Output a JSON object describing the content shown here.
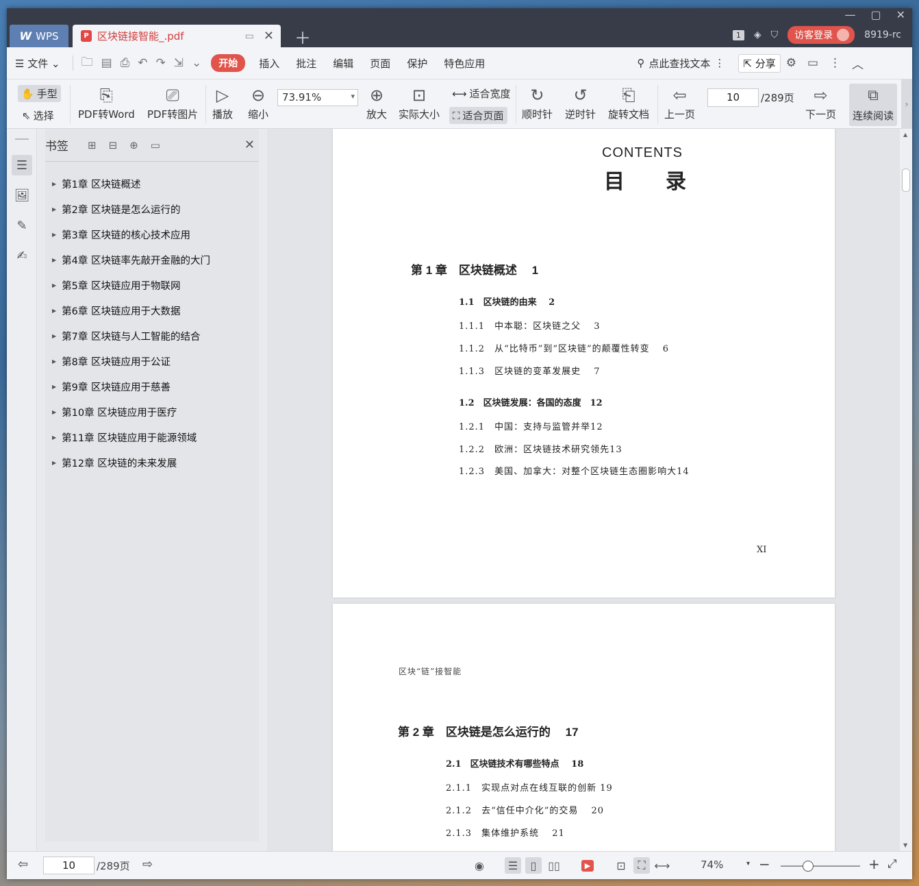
{
  "titlebar": {
    "app_tab": "WPS",
    "doc_tab": "区块链接智能_.pdf",
    "badge": "1",
    "guest_login": "访客登录",
    "user_code": "8919-rc"
  },
  "menubar": {
    "file": "文件",
    "tabs": [
      "开始",
      "插入",
      "批注",
      "编辑",
      "页面",
      "保护",
      "特色应用"
    ],
    "search": "点此查找文本",
    "share": "分享"
  },
  "toolbar": {
    "hand": "手型",
    "select": "选择",
    "pdf_to_word": "PDF转Word",
    "pdf_to_image": "PDF转图片",
    "play": "播放",
    "zoom_out": "缩小",
    "zoom_value": "73.91%",
    "zoom_in": "放大",
    "actual_size": "实际大小",
    "fit_width": "适合宽度",
    "fit_page": "适合页面",
    "clockwise": "顺时针",
    "counterclockwise": "逆时针",
    "rotate_doc": "旋转文档",
    "prev_page": "上一页",
    "page_current": "10",
    "page_total": "/289页",
    "next_page": "下一页",
    "continuous_read": "连续阅读"
  },
  "bookmarks": {
    "title": "书签",
    "items": [
      "第1章 区块链概述",
      "第2章 区块链是怎么运行的",
      "第3章 区块链的核心技术应用",
      "第4章 区块链率先敲开金融的大门",
      "第5章 区块链应用于物联网",
      "第6章 区块链应用于大数据",
      "第7章 区块链与人工智能的结合",
      "第8章 区块链应用于公证",
      "第9章 区块链应用于慈善",
      "第10章 区块链应用于医疗",
      "第11章 区块链应用于能源领域",
      "第12章 区块链的未来发展"
    ]
  },
  "page1": {
    "contents_en": "CONTENTS",
    "contents_zh": "目　　录",
    "chapter": "第 1 章　区块链概述　 1",
    "s1": "1.1　区块链的由来　 2",
    "s111": "1.1.1　中本聪：区块链之父　 3",
    "s112": "1.1.2　从“比特币”到“区块链”的颠覆性转变　 6",
    "s113": "1.1.3　区块链的变革发展史　 7",
    "s2": "1.2　区块链发展：各国的态度　12",
    "s121": "1.2.1　中国：支持与监管并举12",
    "s122": "1.2.2　欧洲：区块链技术研究领先13",
    "s123": "1.2.3　美国、加拿大：对整个区块链生态圈影响大14",
    "folio": "XI"
  },
  "page2": {
    "header": "区块“链”接智能",
    "chapter": "第 2 章　区块链是怎么运行的　 17",
    "s1": "2.1　区块链技术有哪些特点　 18",
    "s211": "2.1.1　实现点对点在线互联的创新 19",
    "s212": "2.1.2　去“信任中介化”的交易　 20",
    "s213": "2.1.3　集体维护系统　 21"
  },
  "statusbar": {
    "page_current": "10",
    "page_total": "/289页",
    "zoom": "74%"
  }
}
